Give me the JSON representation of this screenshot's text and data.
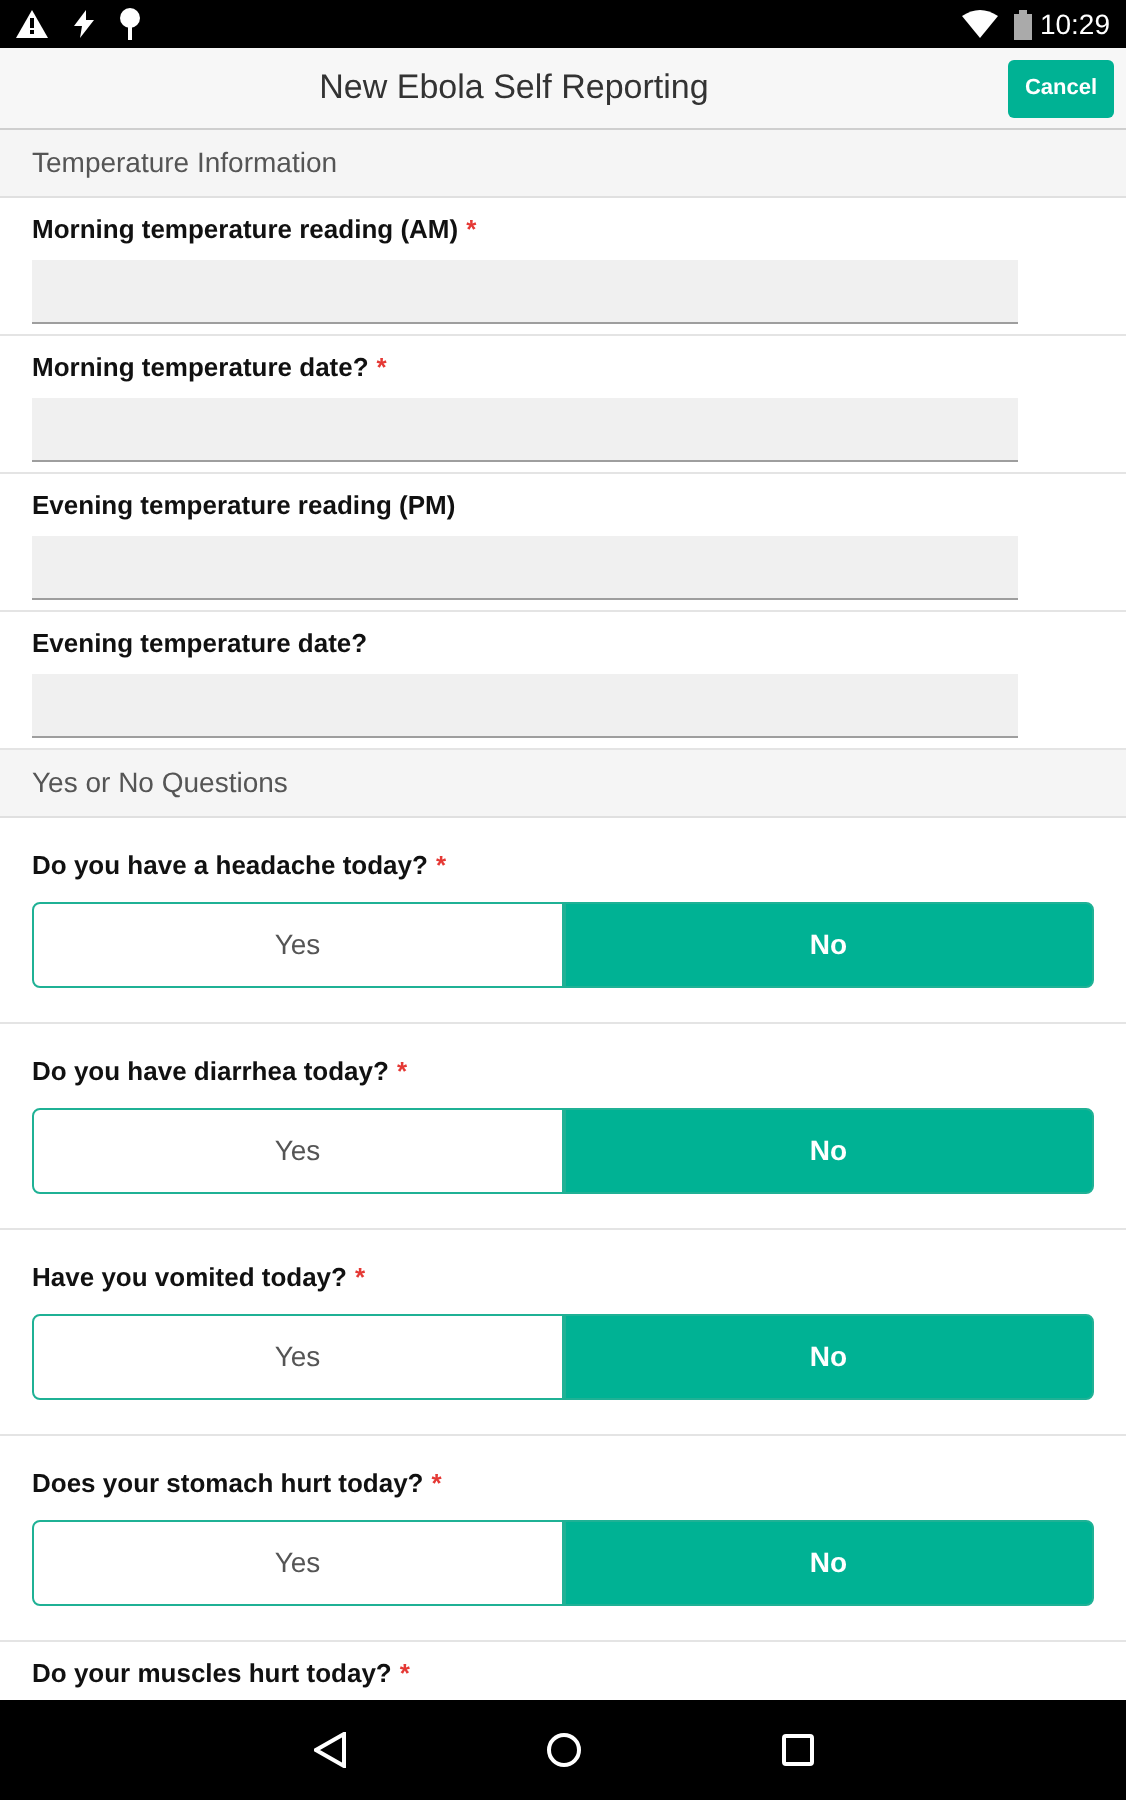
{
  "status_bar": {
    "time": "10:29"
  },
  "header": {
    "title": "New Ebola Self Reporting",
    "cancel": "Cancel"
  },
  "sections": [
    {
      "title": "Temperature Information",
      "items": [
        {
          "kind": "field",
          "label": "Morning temperature reading (AM)",
          "required_mark": "*"
        },
        {
          "kind": "field",
          "label": "Morning temperature date?",
          "required_mark": "*"
        },
        {
          "kind": "field",
          "label": "Evening temperature reading (PM)"
        },
        {
          "kind": "field",
          "label": "Evening temperature date?"
        }
      ]
    },
    {
      "title": "Yes or No Questions",
      "items": [
        {
          "kind": "choice",
          "label": "Do you have a headache today?",
          "required_mark": "*",
          "options": [
            {
              "label": "Yes",
              "selected": false
            },
            {
              "label": "No",
              "selected": true
            }
          ]
        },
        {
          "kind": "choice",
          "label": "Do you have diarrhea today?",
          "required_mark": "*",
          "options": [
            {
              "label": "Yes",
              "selected": false
            },
            {
              "label": "No",
              "selected": true
            }
          ]
        },
        {
          "kind": "choice",
          "label": "Have you vomited today?",
          "required_mark": "*",
          "options": [
            {
              "label": "Yes",
              "selected": false
            },
            {
              "label": "No",
              "selected": true
            }
          ]
        },
        {
          "kind": "choice",
          "label": "Does your stomach hurt today?",
          "required_mark": "*",
          "options": [
            {
              "label": "Yes",
              "selected": false
            },
            {
              "label": "No",
              "selected": true
            }
          ]
        },
        {
          "kind": "label",
          "label": "Do your muscles hurt today?",
          "required_mark": "*"
        }
      ]
    }
  ]
}
